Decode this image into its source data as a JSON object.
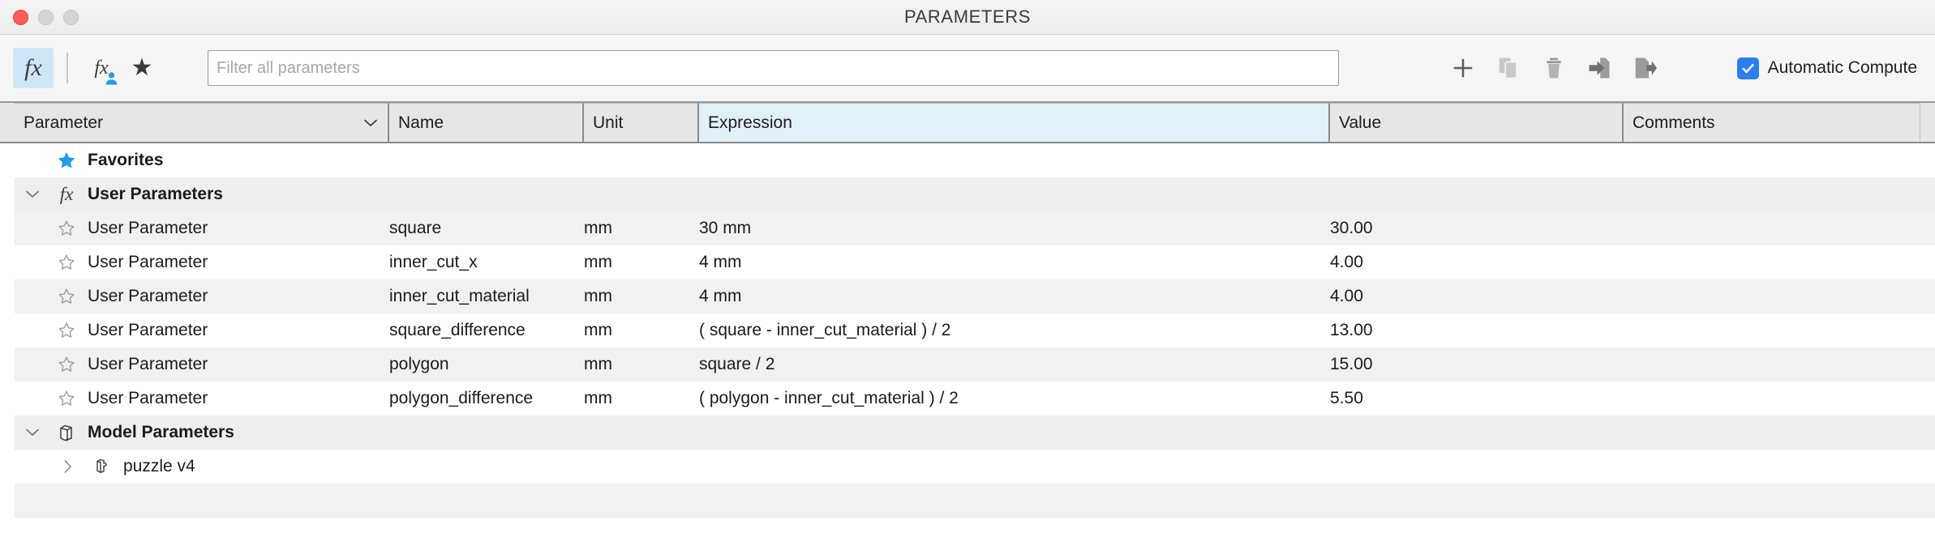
{
  "window": {
    "title": "PARAMETERS",
    "controls": [
      "close",
      "minimize",
      "zoom"
    ]
  },
  "toolbar": {
    "fx_button": "fx",
    "user_parameter_button": "fx-user",
    "favorite_button": "star",
    "add_label": "+",
    "icons": [
      "add-icon",
      "copy-icon",
      "delete-icon",
      "import-icon",
      "export-icon"
    ],
    "automatic_compute_label": "Automatic Compute",
    "automatic_compute_checked": true,
    "accent_color": "#2b7ef0",
    "active_button_bg": "#cfe6f7"
  },
  "filter": {
    "placeholder": "Filter all parameters",
    "value": ""
  },
  "table": {
    "columns": [
      "Parameter",
      "Name",
      "Unit",
      "Expression",
      "Value",
      "Comments"
    ],
    "expression_header_bg": "#e2f0fa",
    "rows": [
      {
        "kind": "group",
        "icon": "star-filled-icon",
        "label": "Favorites",
        "expanded": null,
        "name": "",
        "unit": "",
        "expression": "",
        "value": "",
        "comments": ""
      },
      {
        "kind": "group",
        "icon": "fx-icon",
        "label": "User Parameters",
        "expanded": true,
        "name": "",
        "unit": "",
        "expression": "",
        "value": "",
        "comments": ""
      },
      {
        "kind": "param",
        "icon": "star-outline-icon",
        "label": "User Parameter",
        "name": "square",
        "unit": "mm",
        "expression": "30 mm",
        "value": "30.00",
        "comments": ""
      },
      {
        "kind": "param",
        "icon": "star-outline-icon",
        "label": "User Parameter",
        "name": "inner_cut_x",
        "unit": "mm",
        "expression": "4 mm",
        "value": "4.00",
        "comments": ""
      },
      {
        "kind": "param",
        "icon": "star-outline-icon",
        "label": "User Parameter",
        "name": "inner_cut_material",
        "unit": "mm",
        "expression": "4 mm",
        "value": "4.00",
        "comments": ""
      },
      {
        "kind": "param",
        "icon": "star-outline-icon",
        "label": "User Parameter",
        "name": "square_difference",
        "unit": "mm",
        "expression": "( square - inner_cut_material ) / 2",
        "value": "13.00",
        "comments": ""
      },
      {
        "kind": "param",
        "icon": "star-outline-icon",
        "label": "User Parameter",
        "name": "polygon",
        "unit": "mm",
        "expression": "square / 2",
        "value": "15.00",
        "comments": ""
      },
      {
        "kind": "param",
        "icon": "star-outline-icon",
        "label": "User Parameter",
        "name": "polygon_difference",
        "unit": "mm",
        "expression": "( polygon - inner_cut_material ) / 2",
        "value": "5.50",
        "comments": ""
      },
      {
        "kind": "group",
        "icon": "cube-icon",
        "label": "Model Parameters",
        "expanded": true,
        "name": "",
        "unit": "",
        "expression": "",
        "value": "",
        "comments": ""
      },
      {
        "kind": "component",
        "icon": "component-icon",
        "label": "puzzle v4",
        "expanded": false,
        "name": "",
        "unit": "",
        "expression": "",
        "value": "",
        "comments": ""
      }
    ]
  }
}
